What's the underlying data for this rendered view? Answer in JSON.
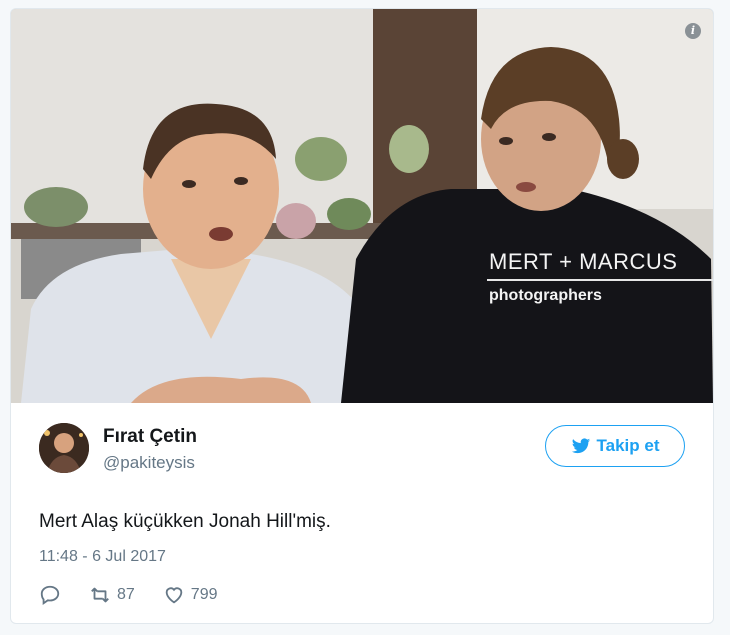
{
  "media": {
    "caption_names": "MERT + MARCUS",
    "caption_role": "photographers",
    "info_icon": "i"
  },
  "tweet": {
    "display_name": "Fırat Çetin",
    "handle": "@pakiteysis",
    "follow_label": "Takip et",
    "text": "Mert Alaş küçükken Jonah Hill'miş.",
    "timestamp": "11:48 - 6 Jul 2017",
    "retweets": "87",
    "likes": "799"
  },
  "colors": {
    "brand_blue": "#1da1f2",
    "muted": "#657786",
    "text": "#14171a"
  },
  "icons": [
    "info-icon",
    "twitter-bird-icon",
    "reply-icon",
    "retweet-icon",
    "heart-icon"
  ]
}
